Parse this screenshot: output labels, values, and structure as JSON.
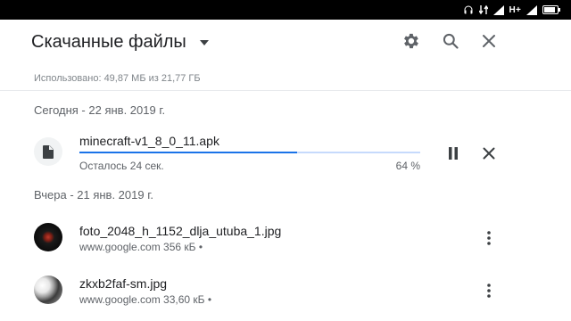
{
  "statusbar": {
    "network_label": "H+"
  },
  "header": {
    "title": "Скачанные файлы",
    "settings_icon": "gear-icon",
    "search_icon": "search-icon",
    "close_icon": "close-icon"
  },
  "storage_text": "Использовано: 49,87 МБ из 21,77 ГБ",
  "sections": {
    "today": {
      "label": "Сегодня - 22 янв. 2019 г.",
      "item": {
        "name": "minecraft-v1_8_0_11.apk",
        "remaining": "Осталось 24 сек.",
        "progress_text": "64 %",
        "progress": 0.64
      }
    },
    "yesterday": {
      "label": "Вчера - 21 янв. 2019 г.",
      "items": [
        {
          "name": "foto_2048_h_1152_dlja_utuba_1.jpg",
          "sub": "www.google.com 356 кБ •"
        },
        {
          "name": "zkxb2faf-sm.jpg",
          "sub": "www.google.com 33,60 кБ •"
        }
      ]
    }
  },
  "colors": {
    "accent": "#1a73e8",
    "progress_track": "#c6dafc",
    "secondary_text": "#5f6368"
  }
}
